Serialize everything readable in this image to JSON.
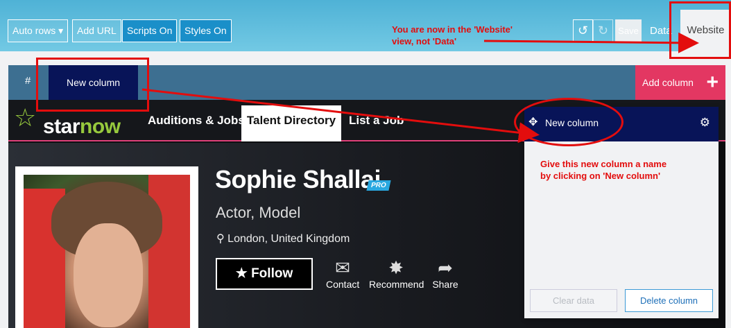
{
  "toolbar": {
    "auto_rows": "Auto rows",
    "auto_rows_caret": "▾",
    "add_url": "Add URL",
    "scripts": "Scripts On",
    "styles": "Styles On",
    "undo_icon": "↺",
    "redo_icon": "↻",
    "save": "Save",
    "data_tab": "Data",
    "website_tab": "Website"
  },
  "columns": {
    "hash": "#",
    "new_column": "New column",
    "add_column": "Add column",
    "add_plus": "+"
  },
  "site": {
    "logo_star": "☆",
    "logo_a": "star",
    "logo_b": "now",
    "nav": [
      "Auditions & Jobs",
      "Talent Directory",
      "List a Job"
    ],
    "name": "Sophie Shallai",
    "pro_badge": "PRO",
    "roles": "Actor, Model",
    "location_icon": "⚲",
    "location": "London, United Kingdom",
    "follow_icon": "★",
    "follow": "Follow",
    "actions": [
      {
        "icon": "✉",
        "label": "Contact"
      },
      {
        "icon": "✸",
        "label": "Recommend"
      },
      {
        "icon": "➦",
        "label": "Share"
      }
    ]
  },
  "panel": {
    "move_icon": "✥",
    "title": "New column",
    "gear_icon": "⚙",
    "clear": "Clear data",
    "delete": "Delete column"
  },
  "annotations": {
    "website_note_1": "You are now in the 'Website'",
    "website_note_2": "view, not 'Data'",
    "name_note_1": "Give this new column a name",
    "name_note_2": "by clicking on 'New column'"
  },
  "colors": {
    "toolbar": "#5ab9db",
    "column_header": "#081458",
    "add_column": "#e33762",
    "annotation": "#e30d0d"
  }
}
